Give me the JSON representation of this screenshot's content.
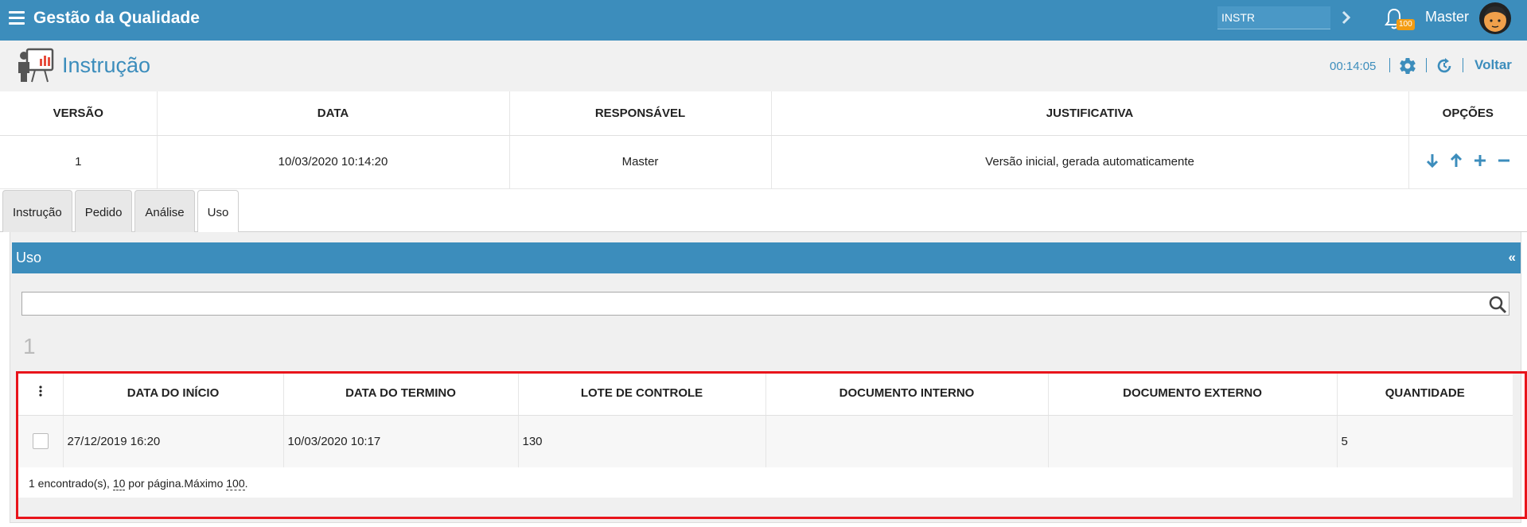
{
  "topbar": {
    "app_title": "Gestão da Qualidade",
    "search_value": "INSTR",
    "notification_count": "100",
    "user_name": "Master"
  },
  "header": {
    "title": "Instrução",
    "timer": "00:14:05",
    "back_label": "Voltar"
  },
  "versions": {
    "columns": [
      "VERSÃO",
      "DATA",
      "RESPONSÁVEL",
      "JUSTIFICATIVA",
      "OPÇÕES"
    ],
    "rows": [
      {
        "version": "1",
        "date": "10/03/2020 10:14:20",
        "responsible": "Master",
        "justification": "Versão inicial, gerada automaticamente"
      }
    ]
  },
  "tabs": [
    {
      "label": "Instrução",
      "active": false
    },
    {
      "label": "Pedido",
      "active": false
    },
    {
      "label": "Análise",
      "active": false
    },
    {
      "label": "Uso",
      "active": true
    }
  ],
  "panel": {
    "title": "Uso",
    "collapse_glyph": "«",
    "search_value": "",
    "page_number": "1",
    "columns": [
      "DATA DO INÍCIO",
      "DATA DO TERMINO",
      "LOTE DE CONTROLE",
      "DOCUMENTO INTERNO",
      "DOCUMENTO EXTERNO",
      "QUANTIDADE"
    ],
    "rows": [
      {
        "start": "27/12/2019 16:20",
        "end": "10/03/2020 10:17",
        "lot": "130",
        "internal_doc": "",
        "external_doc": "",
        "quantity": "5"
      }
    ],
    "footer": {
      "found_text": "1 encontrado(s), ",
      "per_page": "10",
      "per_page_text": " por página.Máximo ",
      "max": "100",
      "end": "."
    }
  },
  "colors": {
    "primary": "#3c8dbc",
    "badge": "#f39c12",
    "highlight": "#e8141b"
  }
}
